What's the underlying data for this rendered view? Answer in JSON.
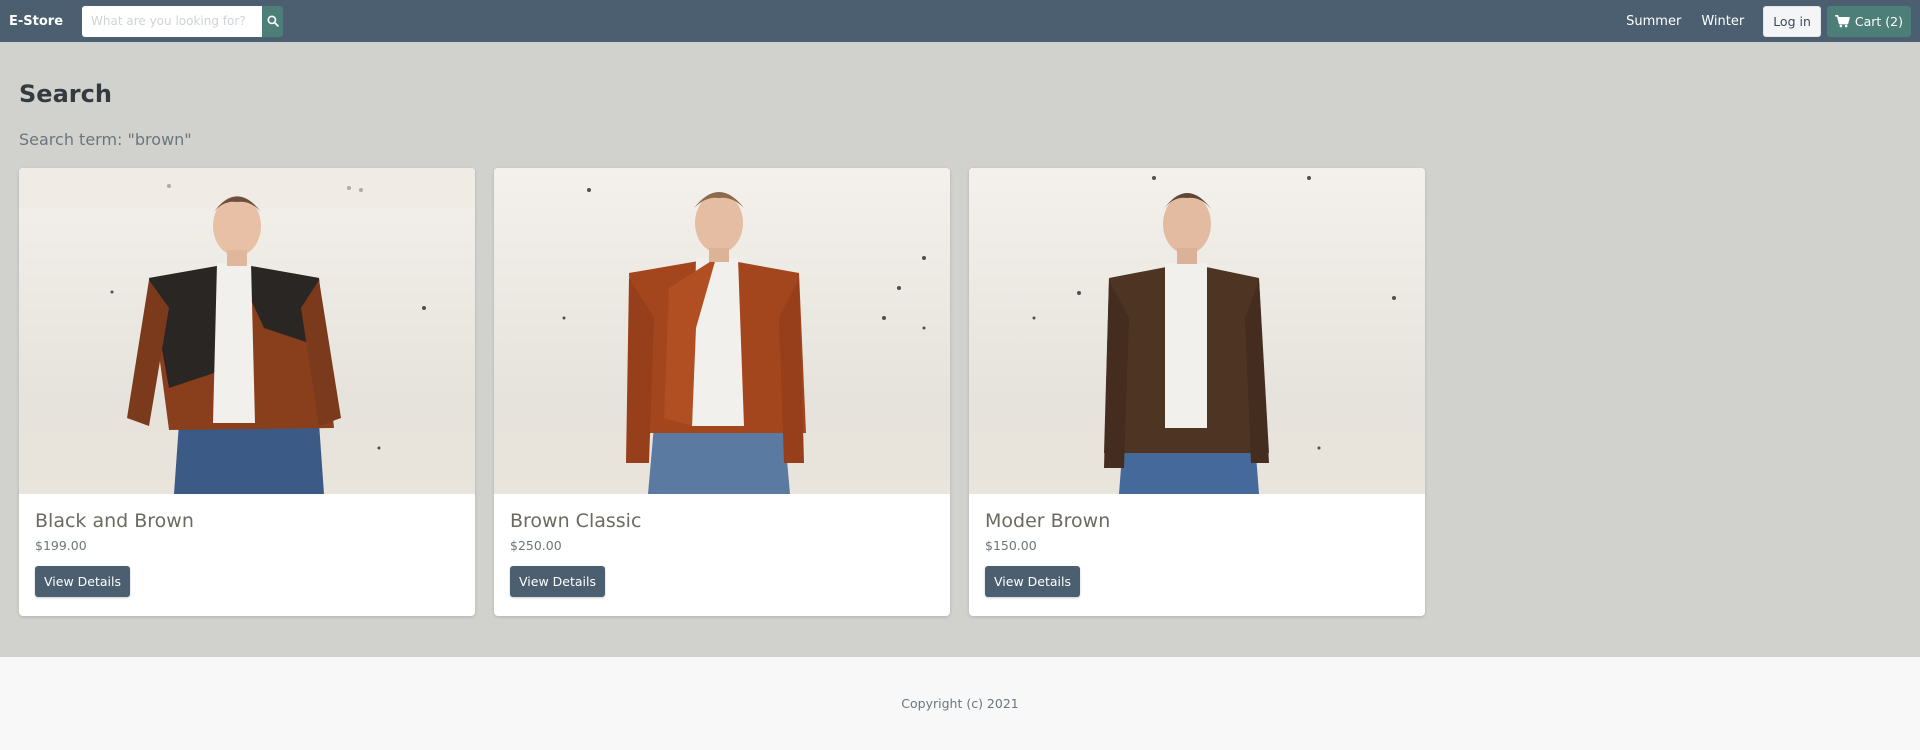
{
  "nav": {
    "brand": "E-Store",
    "search_placeholder": "What are you looking for?",
    "links": [
      "Summer",
      "Winter"
    ],
    "login_label": "Log in",
    "cart_label": "Cart (2)"
  },
  "page": {
    "title": "Search",
    "search_term": "Search term: \"brown\""
  },
  "products": [
    {
      "name": "Black and Brown",
      "price": "$199.00",
      "button": "View Details",
      "jacket_color": "#8a3f1c",
      "accent_color": "#2a2623"
    },
    {
      "name": "Brown Classic",
      "price": "$250.00",
      "button": "View Details",
      "jacket_color": "#a4461d",
      "accent_color": "#a4461d"
    },
    {
      "name": "Moder Brown",
      "price": "$150.00",
      "button": "View Details",
      "jacket_color": "#4e3423",
      "accent_color": "#4e3423"
    }
  ],
  "footer": {
    "copyright": "Copyright (c) 2021"
  },
  "colors": {
    "navbar": "#4b5f71",
    "accent": "#4d7e78",
    "background": "#d1d2cd"
  },
  "icons": {
    "search": "search-icon",
    "cart": "cart-icon"
  }
}
